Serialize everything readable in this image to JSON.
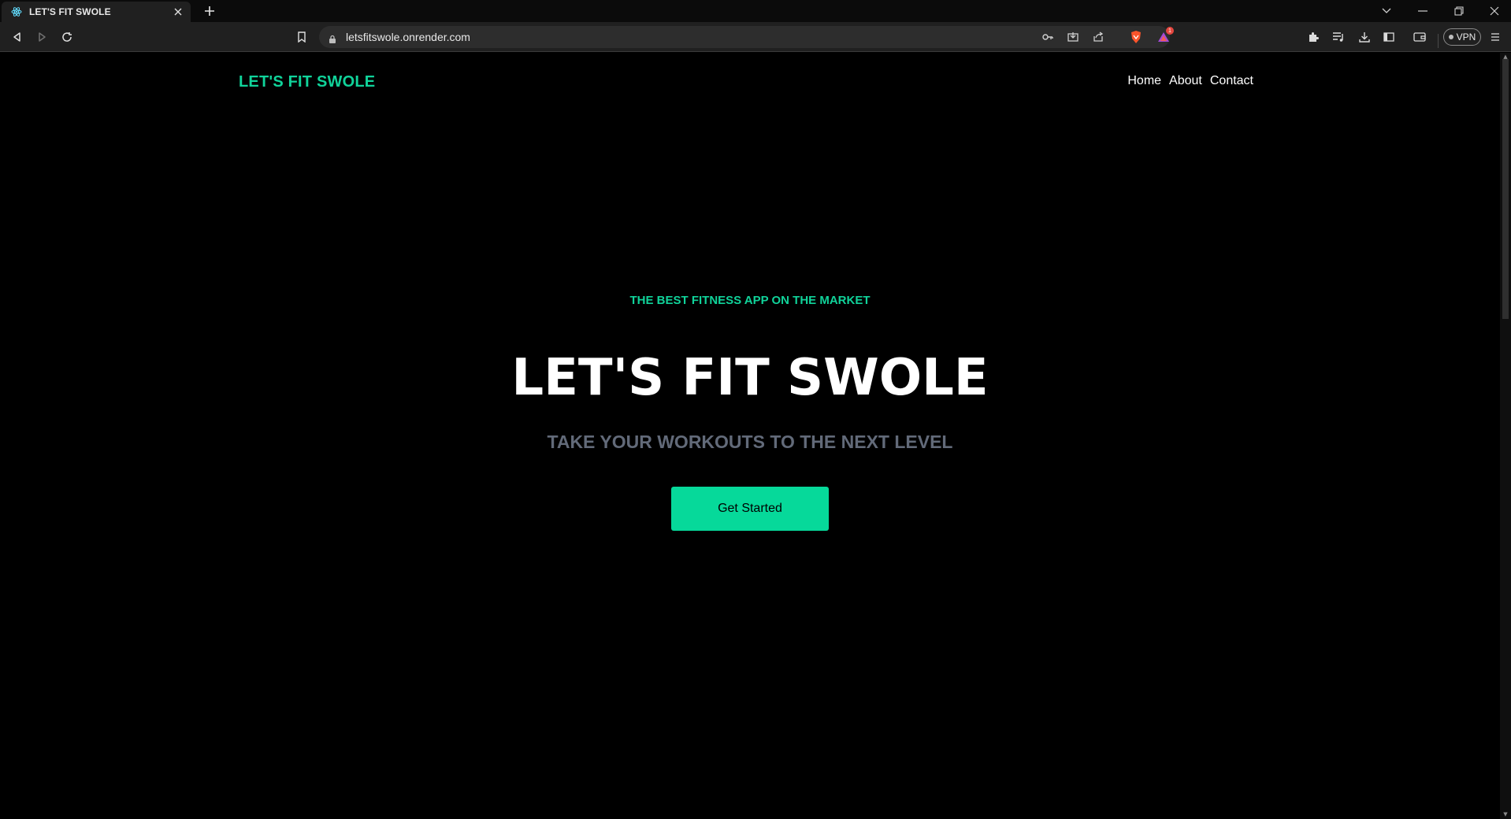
{
  "browser": {
    "tab": {
      "title": "LET'S FIT SWOLE",
      "favicon": "react-atom-icon"
    },
    "url": "letsfitswole.onrender.com",
    "vpn_label": "VPN",
    "notification_count": "1",
    "colors": {
      "tabstrip": "#0b0b0b",
      "toolbar": "#202020",
      "omnibox": "#2d2d2d"
    }
  },
  "site": {
    "brand": "LET'S FIT SWOLE",
    "nav": [
      {
        "label": "Home"
      },
      {
        "label": "About"
      },
      {
        "label": "Contact"
      }
    ],
    "hero": {
      "eyebrow": "THE BEST FITNESS APP ON THE MARKET",
      "title": "LET'S FIT SWOLE",
      "subtitle": "TAKE YOUR WORKOUTS TO THE NEXT LEVEL",
      "cta_label": "Get Started"
    },
    "colors": {
      "accent": "#10d39a",
      "button": "#06d99a",
      "subtitle": "#626a79",
      "background": "#000000"
    }
  }
}
